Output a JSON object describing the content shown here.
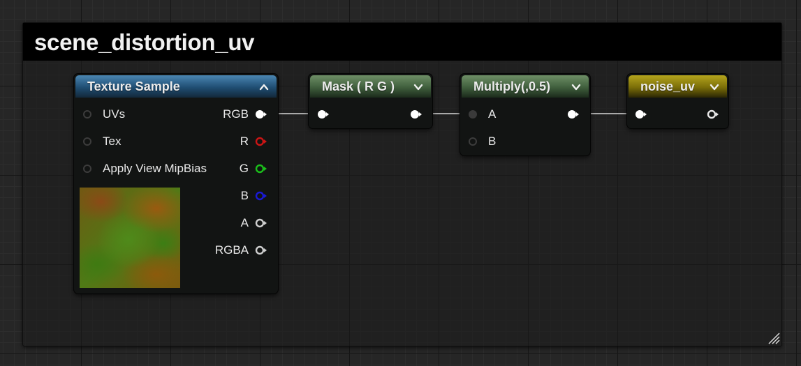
{
  "comment": {
    "title": "scene_distortion_uv"
  },
  "nodes": {
    "texture_sample": {
      "title": "Texture Sample",
      "inputs": [
        "UVs",
        "Tex",
        "Apply View MipBias"
      ],
      "outputs": [
        "RGB",
        "R",
        "G",
        "B",
        "A",
        "RGBA"
      ],
      "preview_icon": "noise-texture-thumbnail"
    },
    "mask": {
      "title": "Mask ( R G )"
    },
    "multiply": {
      "title": "Multiply(,0.5)",
      "inputs": [
        "A",
        "B"
      ]
    },
    "noise_uv": {
      "title": "noise_uv"
    }
  },
  "colors": {
    "pin_default": "#ffffff",
    "pin_r": "#cc1515",
    "pin_g": "#1bbf1b",
    "pin_b": "#1a1ad6",
    "texture_header": "#1f4d72",
    "mask_header": "#3f5e3c",
    "multiply_header": "#3f5e3c",
    "noise_header": "#7a6d08"
  },
  "icons": [
    "collapse-chevron-up-icon",
    "expand-chevron-down-icon",
    "resize-grip-icon",
    "pin-icon"
  ]
}
